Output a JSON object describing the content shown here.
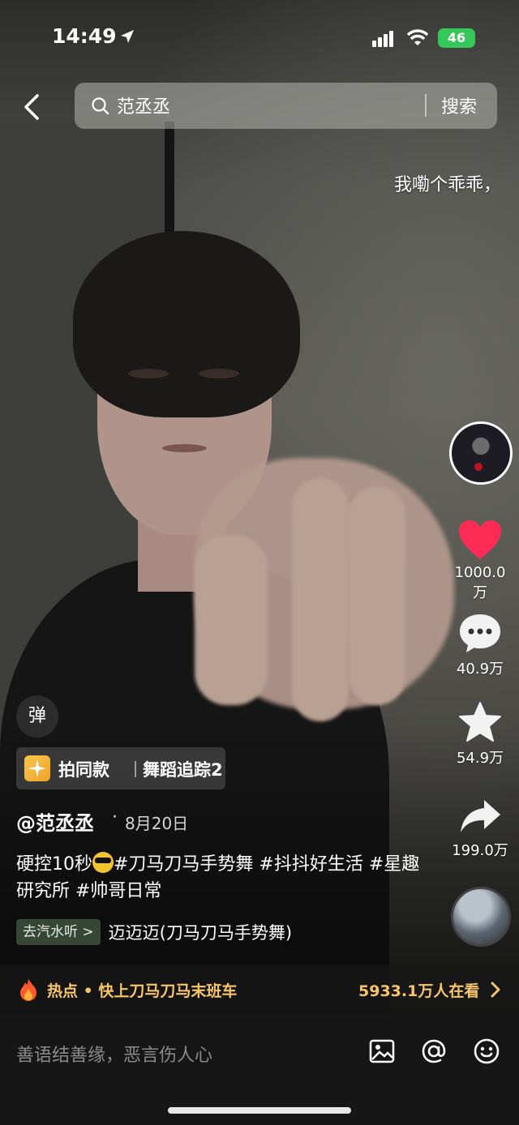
{
  "status_bar": {
    "time": "14:49",
    "battery": "46"
  },
  "search": {
    "query": "范丞丞",
    "button": "搜索"
  },
  "danmaku": "我嘞个乖乖，",
  "rail": {
    "likes": "1000.0万",
    "comments": "40.9万",
    "favorites": "54.9万",
    "shares": "199.0万"
  },
  "danmaku_button": "弹",
  "tag_chip": {
    "primary": "拍同款",
    "secondary": "舞蹈追踪2"
  },
  "post": {
    "author": "@范丞丞",
    "date": "8月20日",
    "caption_before_emoji": "硬控10秒",
    "caption_after_emoji": "#刀马刀马手势舞 #抖抖好生活 #星趣研究所 #帅哥日常"
  },
  "music": {
    "tag": "去汽水听 >",
    "title": "迈迈迈(刀马刀马手势舞)"
  },
  "hot": {
    "text": "热点 • 快上刀马刀马末班车",
    "count": "5933.1万人在看"
  },
  "comment_input": {
    "placeholder": "善语结善缘，恶言伤人心"
  },
  "colors": {
    "like": "#fe2c55",
    "hot": "#f8c56a",
    "battery": "#35c759"
  }
}
